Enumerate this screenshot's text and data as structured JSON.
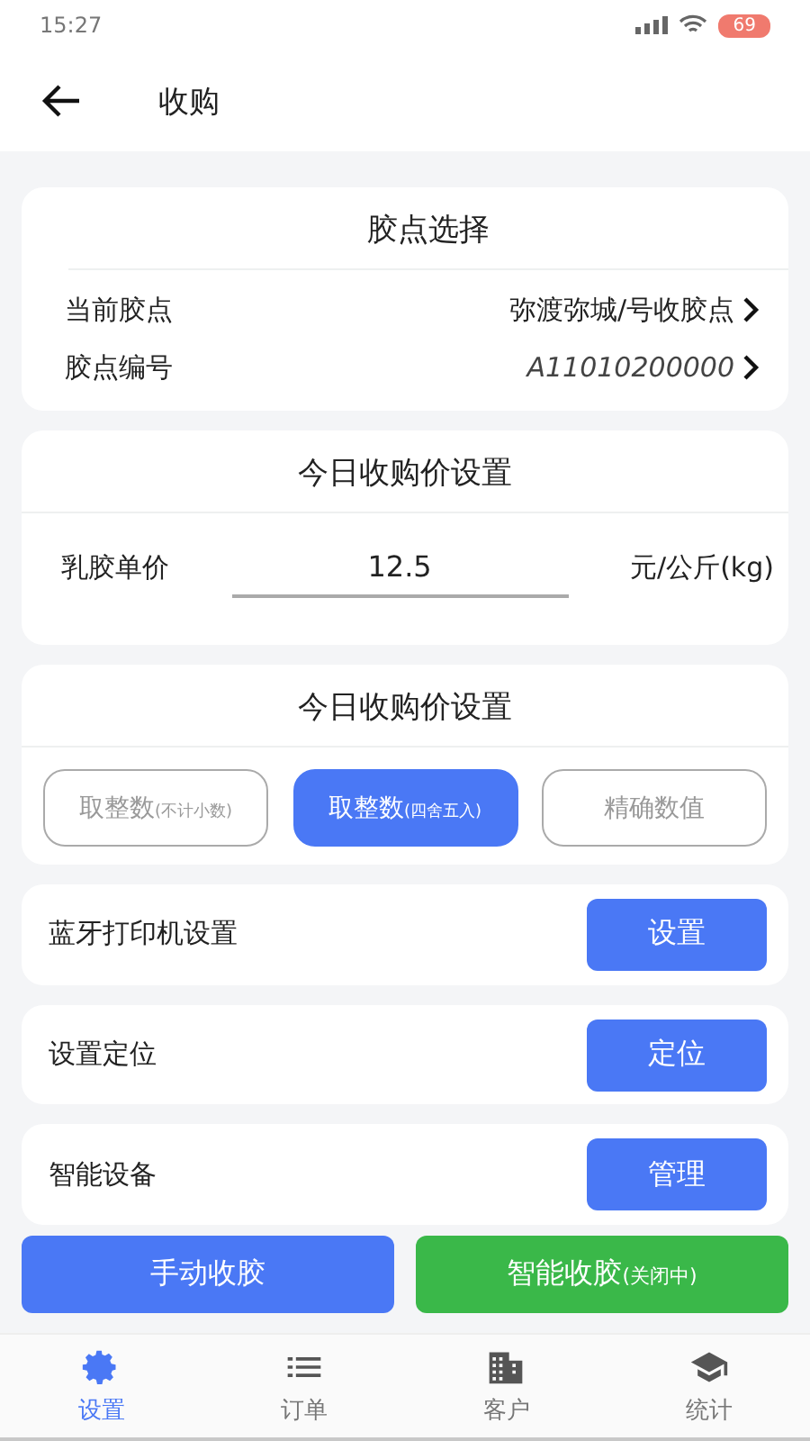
{
  "status_bar": {
    "time": "15:27",
    "battery": "69"
  },
  "header": {
    "title": "收购"
  },
  "station_card": {
    "title": "胶点选择",
    "rows": [
      {
        "label": "当前胶点",
        "value": "弥渡弥城/号收胶点"
      },
      {
        "label": "胶点编号",
        "value": "A11010200000"
      }
    ]
  },
  "price_card": {
    "title": "今日收购价设置",
    "label": "乳胶单价",
    "value": "12.5",
    "unit": "元/公斤(kg)"
  },
  "rounding_card": {
    "title": "今日收购价设置",
    "options": [
      {
        "label": "取整数",
        "note": "(不计小数)",
        "selected": false
      },
      {
        "label": "取整数",
        "note": "(四舍五入)",
        "selected": true
      },
      {
        "label": "精确数值",
        "selected": false
      }
    ]
  },
  "settings": [
    {
      "label": "蓝牙打印机设置",
      "button": "设置"
    },
    {
      "label": "设置定位",
      "button": "定位"
    },
    {
      "label": "智能设备",
      "button": "管理"
    }
  ],
  "actions": [
    {
      "label": "手动收胶",
      "kind": "manual"
    },
    {
      "label": "智能收胶",
      "note": "(关闭中)",
      "kind": "smart"
    }
  ],
  "tabs": [
    {
      "label": "设置",
      "kind": "gear",
      "selected": true
    },
    {
      "label": "订单",
      "kind": "list",
      "selected": false
    },
    {
      "label": "客户",
      "kind": "building",
      "selected": false
    },
    {
      "label": "统计",
      "kind": "cap",
      "selected": false
    }
  ]
}
